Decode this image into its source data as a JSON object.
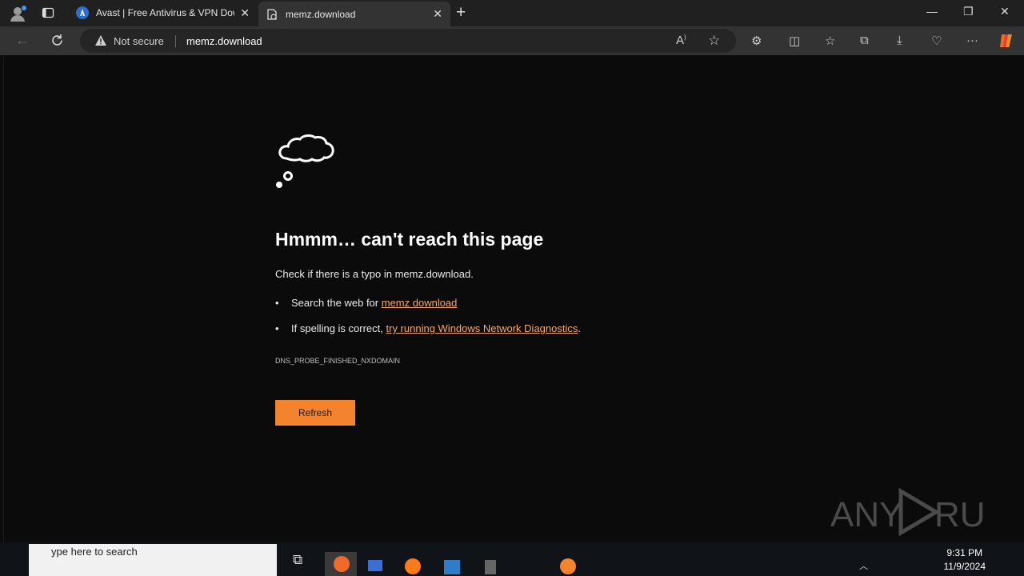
{
  "browser": {
    "tabs": [
      {
        "title": "Avast | Free Antivirus & VPN Dow",
        "active": false
      },
      {
        "title": "memz.download",
        "active": true
      }
    ],
    "security_label": "Not secure",
    "url": "memz.download"
  },
  "error_page": {
    "heading": "Hmmm… can't reach this page",
    "check_text": "Check if there is a typo in memz.download.",
    "bullet1_prefix": "Search the web for ",
    "bullet1_link": "memz download",
    "bullet2_prefix": "If spelling is correct, ",
    "bullet2_link": "try running Windows Network Diagnostics",
    "bullet2_suffix": ".",
    "error_code": "DNS_PROBE_FINISHED_NXDOMAIN",
    "refresh_label": "Refresh"
  },
  "watermark": {
    "text_left": "ANY",
    "text_right": "RUN"
  },
  "taskbar": {
    "search_placeholder": "ype here to search",
    "time": "9:31 PM",
    "date": "11/9/2024"
  },
  "colors": {
    "accent": "#f4832e",
    "link": "#f7a86a",
    "background": "#0b0b0b"
  }
}
